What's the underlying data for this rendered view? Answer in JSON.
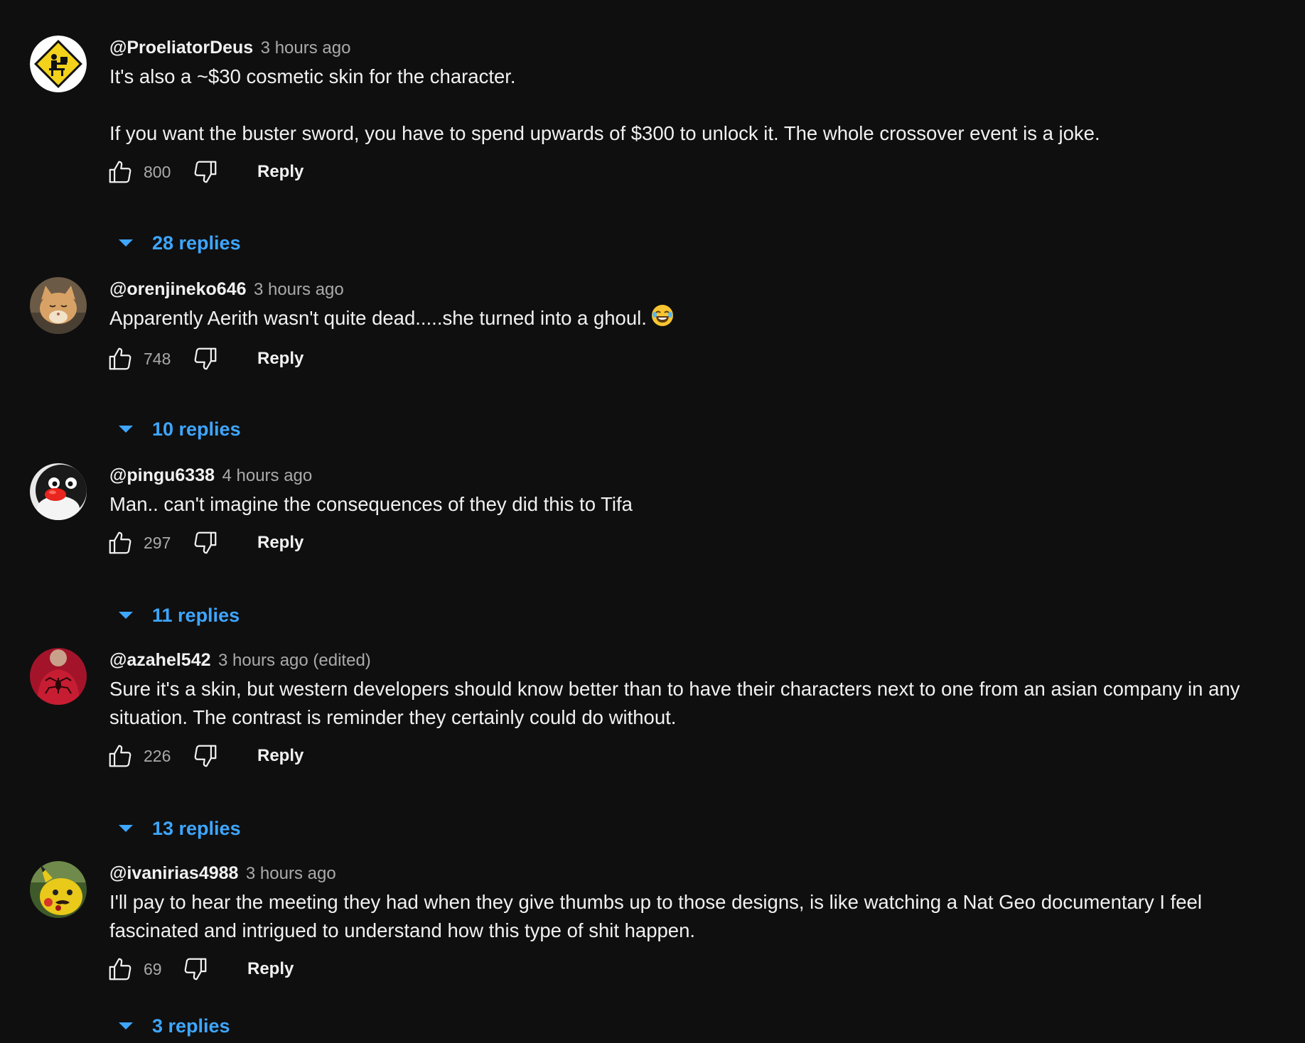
{
  "comments": [
    {
      "author": "@ProeliatorDeus",
      "time": "3 hours ago",
      "text": "It's also a ~$30 cosmetic skin for the character.\n\nIf you want the buster sword, you have to spend upwards of $300 to unlock it. The whole crossover event is a joke.",
      "likes": "800",
      "reply_label": "Reply",
      "replies_label": "28 replies",
      "avatar": "warning-sign-computer-user"
    },
    {
      "author": "@orenjineko646",
      "time": "3 hours ago",
      "text": "Apparently Aerith wasn't quite dead.....she turned into a ghoul.",
      "emoji": "😂",
      "likes": "748",
      "reply_label": "Reply",
      "replies_label": "10 replies",
      "avatar": "orange-cat-photo"
    },
    {
      "author": "@pingu6338",
      "time": "4 hours ago",
      "text": "Man.. can't imagine the consequences of they did this to Tifa",
      "likes": "297",
      "reply_label": "Reply",
      "replies_label": "11 replies",
      "avatar": "pingu-penguin-face"
    },
    {
      "author": "@azahel542",
      "time": "3 hours ago (edited)",
      "text": "Sure it's a skin, but western developers should know better than to have their characters next to one from an asian company in any situation. The contrast is reminder they certainly could do without.",
      "likes": "226",
      "reply_label": "Reply",
      "replies_label": "13 replies",
      "avatar": "red-spider-shirt"
    },
    {
      "author": "@ivanirias4988",
      "time": "3 hours ago",
      "text": "I'll pay to hear the meeting they had when they give thumbs up to those designs, is like watching a Nat Geo documentary I feel fascinated and intrigued to understand how this type of shit happen.",
      "likes": "69",
      "reply_label": "Reply",
      "replies_label": "3 replies",
      "avatar": "yellow-pikachu-mustache"
    }
  ],
  "colors": {
    "background": "#0f0f0f",
    "text": "#f1f1f1",
    "secondary": "#aaaaaa",
    "link": "#3ea6ff"
  }
}
